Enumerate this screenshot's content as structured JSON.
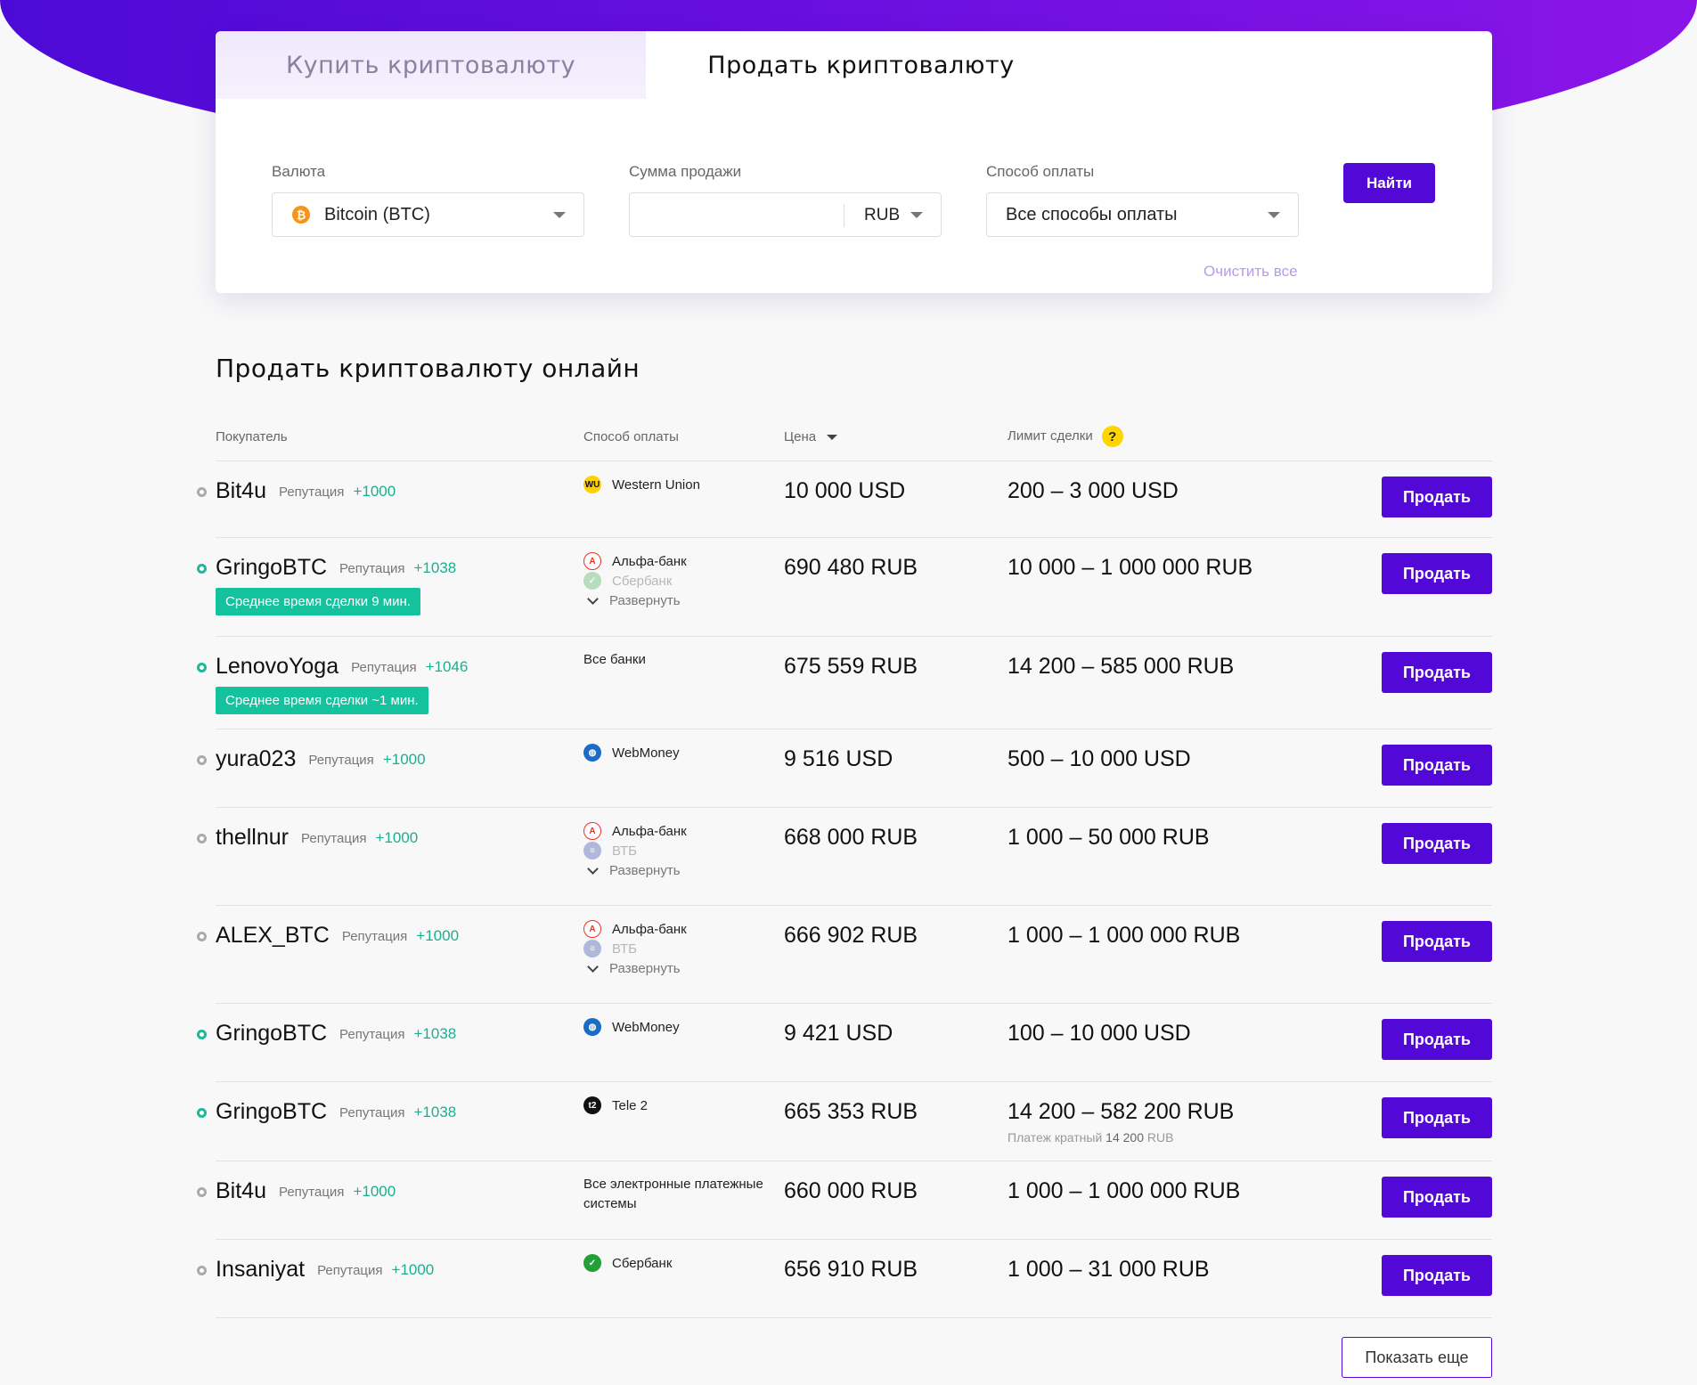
{
  "tabs": {
    "buy": "Купить криптовалюту",
    "sell": "Продать криптовалюту"
  },
  "filters": {
    "currency_label": "Валюта",
    "currency_value": "Bitcoin (BTC)",
    "amount_label": "Сумма продажи",
    "amount_value": "",
    "amount_currency": "RUB",
    "payment_label": "Способ оплаты",
    "payment_value": "Все способы оплаты",
    "find_button": "Найти",
    "clear_all": "Очистить все"
  },
  "section_title": "Продать криптовалюту онлайн",
  "table": {
    "headers": {
      "buyer": "Покупатель",
      "payment": "Способ оплаты",
      "price": "Цена",
      "limit": "Лимит сделки",
      "help": "?"
    },
    "rep_label": "Репутация",
    "expand_label": "Развернуть",
    "sell_button": "Продать",
    "rows": [
      {
        "buyer": "Bit4u",
        "rep": "+1000",
        "online": false,
        "badge": "",
        "payments": [
          "Western Union"
        ],
        "faded": [],
        "expand": false,
        "price": "10 000 USD",
        "limit": "200 – 3 000 USD",
        "note": ""
      },
      {
        "buyer": "GringoBTC",
        "rep": "+1038",
        "online": true,
        "badge": "Среднее время сделки 9 мин.",
        "payments": [
          "Альфа-банк"
        ],
        "faded": [
          "Сбербанк"
        ],
        "expand": true,
        "price": "690 480 RUB",
        "limit": "10 000 – 1 000 000 RUB",
        "note": ""
      },
      {
        "buyer": "LenovoYoga",
        "rep": "+1046",
        "online": true,
        "badge": "Среднее время сделки ~1 мин.",
        "payments": [
          "Все банки"
        ],
        "faded": [],
        "expand": false,
        "price": "675 559 RUB",
        "limit": "14 200 – 585 000 RUB",
        "note": ""
      },
      {
        "buyer": "yura023",
        "rep": "+1000",
        "online": false,
        "badge": "",
        "payments": [
          "WebMoney"
        ],
        "faded": [],
        "expand": false,
        "price": "9 516 USD",
        "limit": "500 – 10 000 USD",
        "note": ""
      },
      {
        "buyer": "thellnur",
        "rep": "+1000",
        "online": false,
        "badge": "",
        "payments": [
          "Альфа-банк"
        ],
        "faded": [
          "ВТБ"
        ],
        "expand": true,
        "price": "668 000 RUB",
        "limit": "1 000 – 50 000 RUB",
        "note": ""
      },
      {
        "buyer": "ALEX_BTC",
        "rep": "+1000",
        "online": false,
        "badge": "",
        "payments": [
          "Альфа-банк"
        ],
        "faded": [
          "ВТБ"
        ],
        "expand": true,
        "price": "666 902 RUB",
        "limit": "1 000 – 1 000 000 RUB",
        "note": ""
      },
      {
        "buyer": "GringoBTC",
        "rep": "+1038",
        "online": true,
        "badge": "",
        "payments": [
          "WebMoney"
        ],
        "faded": [],
        "expand": false,
        "price": "9 421 USD",
        "limit": "100 – 10 000 USD",
        "note": ""
      },
      {
        "buyer": "GringoBTC",
        "rep": "+1038",
        "online": true,
        "badge": "",
        "payments": [
          "Tele 2"
        ],
        "faded": [],
        "expand": false,
        "price": "665 353 RUB",
        "limit": "14 200 – 582 200 RUB",
        "note": {
          "prefix": "Платеж кратный",
          "amount": "14 200",
          "currency": "RUB"
        }
      },
      {
        "buyer": "Bit4u",
        "rep": "+1000",
        "online": false,
        "badge": "",
        "payments": [
          "Все электронные платежные системы"
        ],
        "faded": [],
        "expand": false,
        "price": "660 000 RUB",
        "limit": "1 000 – 1 000 000 RUB",
        "note": ""
      },
      {
        "buyer": "Insaniyat",
        "rep": "+1000",
        "online": false,
        "badge": "",
        "payments": [
          "Сбербанк"
        ],
        "faded": [],
        "expand": false,
        "price": "656 910 RUB",
        "limit": "1 000 – 31 000 RUB",
        "note": ""
      }
    ]
  },
  "show_more": "Показать еще",
  "colors": {
    "accent": "#5208d6",
    "reputation": "#19b08f",
    "badge": "#14c29d",
    "clear_link": "#b79be8"
  }
}
